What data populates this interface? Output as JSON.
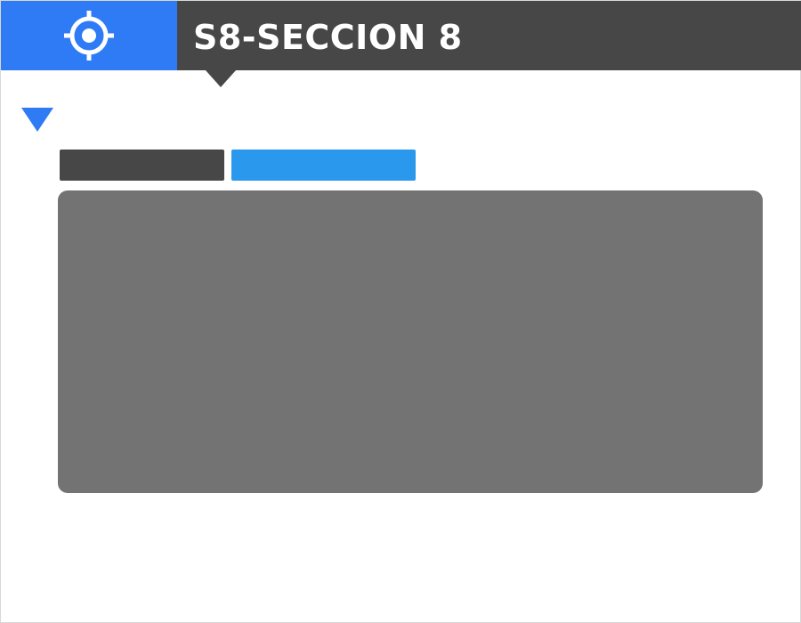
{
  "header": {
    "title": "S8-SECCION 8",
    "icon": "crosshair-icon"
  },
  "colors": {
    "accent_blue": "#2f7bf5",
    "tab_blue": "#2a98ed",
    "header_dark": "#474747",
    "panel_gray": "#737373"
  },
  "collapse_toggle": {
    "icon": "triangle-down-icon"
  }
}
